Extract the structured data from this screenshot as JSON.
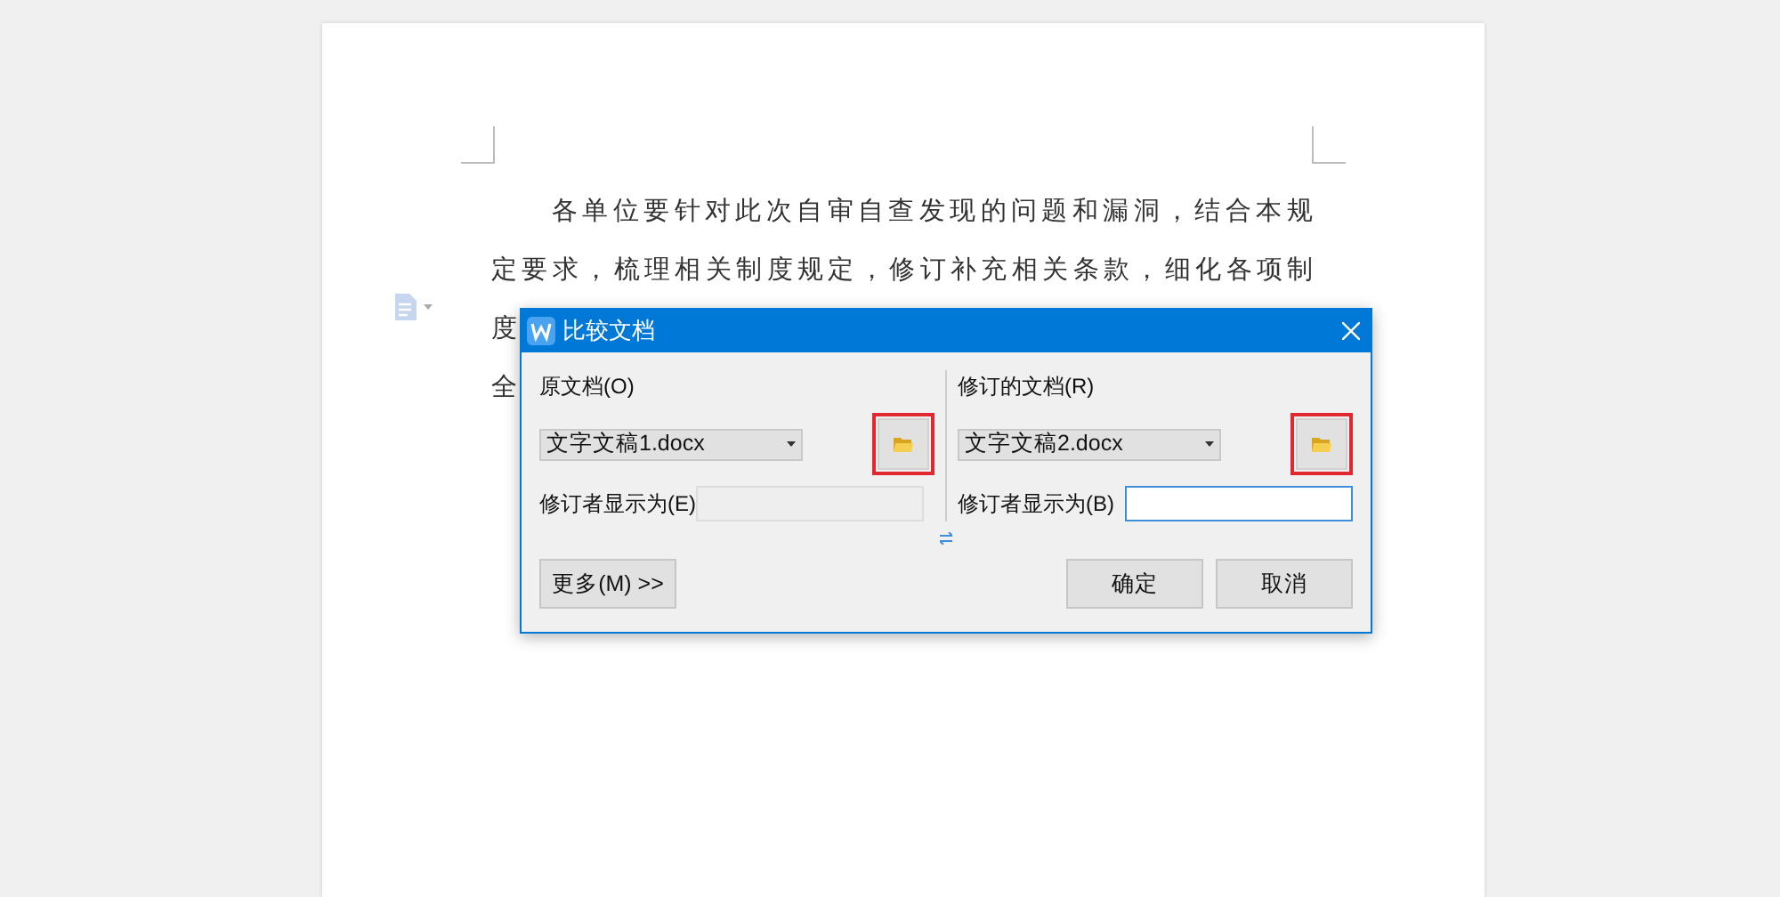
{
  "document": {
    "paragraph_lines": [
      "各单位要针对此次自审自查发现的问题和漏洞，结合本规",
      "定要求，梳理相关制度规定，修订补充相关条款，细化各项制",
      "度",
      "全"
    ]
  },
  "dialog": {
    "title": "比较文档",
    "original": {
      "label": "原文档(O)",
      "file": "文字文稿1.docx",
      "browse_highlighted": true,
      "author_label": "修订者显示为(E)",
      "author_disabled": true
    },
    "revised": {
      "label": "修订的文档(R)",
      "file": "文字文稿2.docx",
      "browse_highlighted": true,
      "author_label": "修订者显示为(B)",
      "author_disabled": false,
      "author_focused": true
    },
    "buttons": [
      {
        "kind": "more",
        "label": "更多(M) >>"
      },
      {
        "kind": "ok",
        "label": "确定"
      },
      {
        "kind": "cancel",
        "label": "取消"
      }
    ]
  }
}
